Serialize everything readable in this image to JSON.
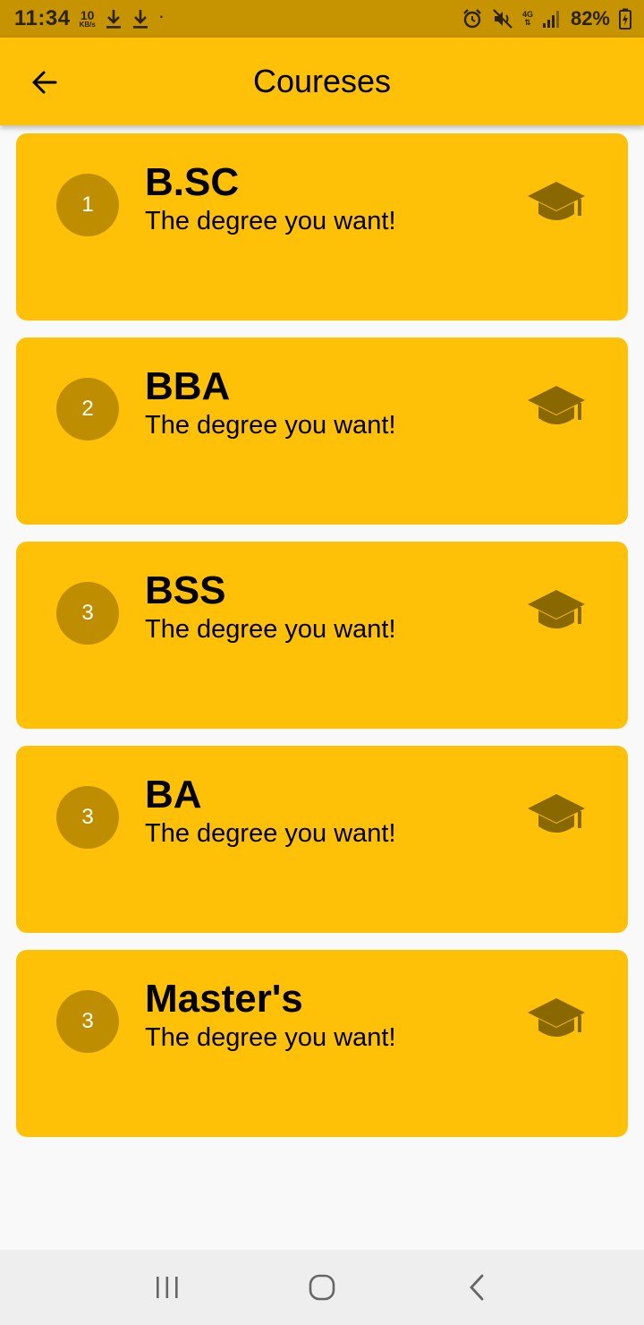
{
  "status_bar": {
    "time": "11:34",
    "net_speed_value": "10",
    "net_speed_unit": "KB/s",
    "network_type": "4G",
    "battery": "82%"
  },
  "app_bar": {
    "title": "Coureses"
  },
  "courses": [
    {
      "number": "1",
      "title": "B.SC",
      "subtitle": "The degree you want!"
    },
    {
      "number": "2",
      "title": "BBA",
      "subtitle": "The degree you want!"
    },
    {
      "number": "3",
      "title": "BSS",
      "subtitle": "The degree you want!"
    },
    {
      "number": "3",
      "title": "BA",
      "subtitle": "The degree you want!"
    },
    {
      "number": "3",
      "title": "Master's",
      "subtitle": "The degree you want!"
    }
  ],
  "icons": {
    "back": "arrow-left-icon",
    "course": "graduation-cap-icon",
    "nav_recents": "recents-icon",
    "nav_home": "home-icon",
    "nav_back": "back-chevron-icon"
  },
  "colors": {
    "status_bar": "#c69400",
    "app_bar": "#ffc107",
    "card": "#ffc107",
    "avatar": "#bf8d00",
    "icon": "#8a6800",
    "background": "#f9f9f9"
  }
}
